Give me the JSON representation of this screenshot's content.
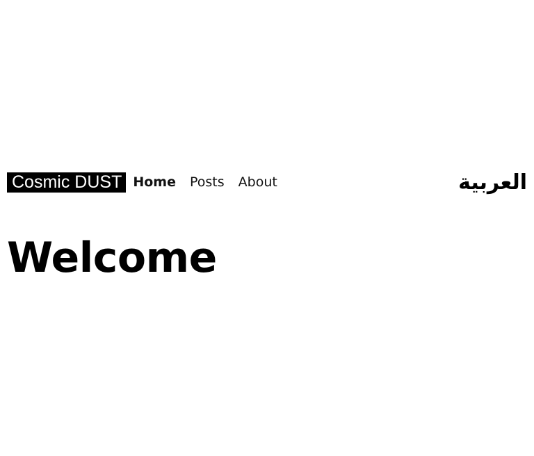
{
  "header": {
    "logo_text": "Cosmic DUST",
    "nav": {
      "home": "Home",
      "posts": "Posts",
      "about": "About"
    },
    "language_switch": "العربية"
  },
  "main": {
    "title": "Welcome"
  },
  "colors": {
    "background": "#ffffff",
    "logo_background": "#000000",
    "logo_text": "#ffffff",
    "text": "#111111"
  }
}
